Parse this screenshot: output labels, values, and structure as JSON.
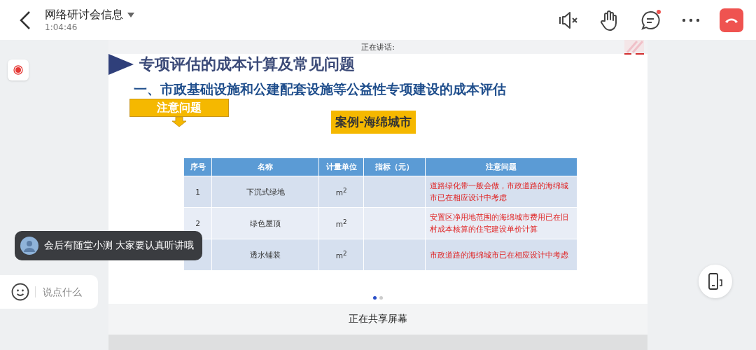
{
  "header": {
    "title": "网络研讨会信息",
    "duration": "1:04:46"
  },
  "speaking_label": "正在讲话:",
  "slide": {
    "title": "专项评估的成本计算及常见问题",
    "subtitle": "一、市政基础设施和公建配套设施等公益性专项建设的成本评估",
    "note_label": "注意问题",
    "case_label": "案例-海绵城市",
    "table": {
      "columns": [
        "序号",
        "名称",
        "计量单位",
        "指标（元）",
        "注意问题"
      ],
      "rows": [
        {
          "no": "1",
          "name": "下沉式绿地",
          "unit": "m$^{2}$",
          "remark": "道路绿化带一般会做，市政道路的海绵城市已在相应设计中考虑"
        },
        {
          "no": "2",
          "name": "绿色屋顶",
          "unit": "m$^{2}$",
          "remark": "安置区净用地范围的海绵城市费用已在旧村成本核算的住宅建设单价计算"
        },
        {
          "name": "透水铺装",
          "unit": "m$^{2}$",
          "remark": "市政道路的海绵城市已在相应设计中考虑"
        }
      ]
    }
  },
  "pages": [
    {
      "selected": true
    },
    {
      "selected": false
    }
  ],
  "chat_message": {
    "text": "会后有随堂小测 大家要认真听讲哦"
  },
  "comment_field": {
    "placeholder": "说点什么"
  },
  "status": "正在共享屏幕"
}
